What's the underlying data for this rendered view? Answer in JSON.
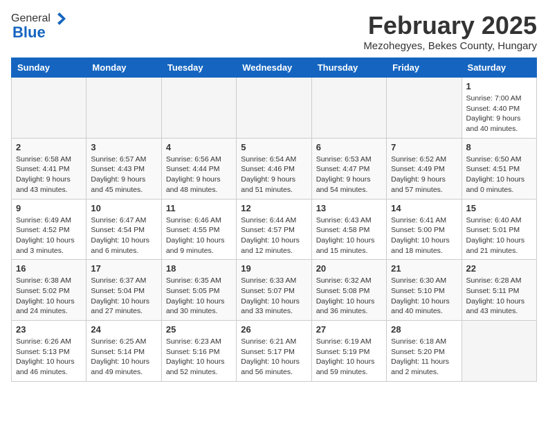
{
  "logo": {
    "general": "General",
    "blue": "Blue"
  },
  "header": {
    "month": "February 2025",
    "location": "Mezohegyes, Bekes County, Hungary"
  },
  "days_of_week": [
    "Sunday",
    "Monday",
    "Tuesday",
    "Wednesday",
    "Thursday",
    "Friday",
    "Saturday"
  ],
  "weeks": [
    [
      {
        "day": "",
        "info": ""
      },
      {
        "day": "",
        "info": ""
      },
      {
        "day": "",
        "info": ""
      },
      {
        "day": "",
        "info": ""
      },
      {
        "day": "",
        "info": ""
      },
      {
        "day": "",
        "info": ""
      },
      {
        "day": "1",
        "info": "Sunrise: 7:00 AM\nSunset: 4:40 PM\nDaylight: 9 hours and 40 minutes."
      }
    ],
    [
      {
        "day": "2",
        "info": "Sunrise: 6:58 AM\nSunset: 4:41 PM\nDaylight: 9 hours and 43 minutes."
      },
      {
        "day": "3",
        "info": "Sunrise: 6:57 AM\nSunset: 4:43 PM\nDaylight: 9 hours and 45 minutes."
      },
      {
        "day": "4",
        "info": "Sunrise: 6:56 AM\nSunset: 4:44 PM\nDaylight: 9 hours and 48 minutes."
      },
      {
        "day": "5",
        "info": "Sunrise: 6:54 AM\nSunset: 4:46 PM\nDaylight: 9 hours and 51 minutes."
      },
      {
        "day": "6",
        "info": "Sunrise: 6:53 AM\nSunset: 4:47 PM\nDaylight: 9 hours and 54 minutes."
      },
      {
        "day": "7",
        "info": "Sunrise: 6:52 AM\nSunset: 4:49 PM\nDaylight: 9 hours and 57 minutes."
      },
      {
        "day": "8",
        "info": "Sunrise: 6:50 AM\nSunset: 4:51 PM\nDaylight: 10 hours and 0 minutes."
      }
    ],
    [
      {
        "day": "9",
        "info": "Sunrise: 6:49 AM\nSunset: 4:52 PM\nDaylight: 10 hours and 3 minutes."
      },
      {
        "day": "10",
        "info": "Sunrise: 6:47 AM\nSunset: 4:54 PM\nDaylight: 10 hours and 6 minutes."
      },
      {
        "day": "11",
        "info": "Sunrise: 6:46 AM\nSunset: 4:55 PM\nDaylight: 10 hours and 9 minutes."
      },
      {
        "day": "12",
        "info": "Sunrise: 6:44 AM\nSunset: 4:57 PM\nDaylight: 10 hours and 12 minutes."
      },
      {
        "day": "13",
        "info": "Sunrise: 6:43 AM\nSunset: 4:58 PM\nDaylight: 10 hours and 15 minutes."
      },
      {
        "day": "14",
        "info": "Sunrise: 6:41 AM\nSunset: 5:00 PM\nDaylight: 10 hours and 18 minutes."
      },
      {
        "day": "15",
        "info": "Sunrise: 6:40 AM\nSunset: 5:01 PM\nDaylight: 10 hours and 21 minutes."
      }
    ],
    [
      {
        "day": "16",
        "info": "Sunrise: 6:38 AM\nSunset: 5:02 PM\nDaylight: 10 hours and 24 minutes."
      },
      {
        "day": "17",
        "info": "Sunrise: 6:37 AM\nSunset: 5:04 PM\nDaylight: 10 hours and 27 minutes."
      },
      {
        "day": "18",
        "info": "Sunrise: 6:35 AM\nSunset: 5:05 PM\nDaylight: 10 hours and 30 minutes."
      },
      {
        "day": "19",
        "info": "Sunrise: 6:33 AM\nSunset: 5:07 PM\nDaylight: 10 hours and 33 minutes."
      },
      {
        "day": "20",
        "info": "Sunrise: 6:32 AM\nSunset: 5:08 PM\nDaylight: 10 hours and 36 minutes."
      },
      {
        "day": "21",
        "info": "Sunrise: 6:30 AM\nSunset: 5:10 PM\nDaylight: 10 hours and 40 minutes."
      },
      {
        "day": "22",
        "info": "Sunrise: 6:28 AM\nSunset: 5:11 PM\nDaylight: 10 hours and 43 minutes."
      }
    ],
    [
      {
        "day": "23",
        "info": "Sunrise: 6:26 AM\nSunset: 5:13 PM\nDaylight: 10 hours and 46 minutes."
      },
      {
        "day": "24",
        "info": "Sunrise: 6:25 AM\nSunset: 5:14 PM\nDaylight: 10 hours and 49 minutes."
      },
      {
        "day": "25",
        "info": "Sunrise: 6:23 AM\nSunset: 5:16 PM\nDaylight: 10 hours and 52 minutes."
      },
      {
        "day": "26",
        "info": "Sunrise: 6:21 AM\nSunset: 5:17 PM\nDaylight: 10 hours and 56 minutes."
      },
      {
        "day": "27",
        "info": "Sunrise: 6:19 AM\nSunset: 5:19 PM\nDaylight: 10 hours and 59 minutes."
      },
      {
        "day": "28",
        "info": "Sunrise: 6:18 AM\nSunset: 5:20 PM\nDaylight: 11 hours and 2 minutes."
      },
      {
        "day": "",
        "info": ""
      }
    ]
  ]
}
